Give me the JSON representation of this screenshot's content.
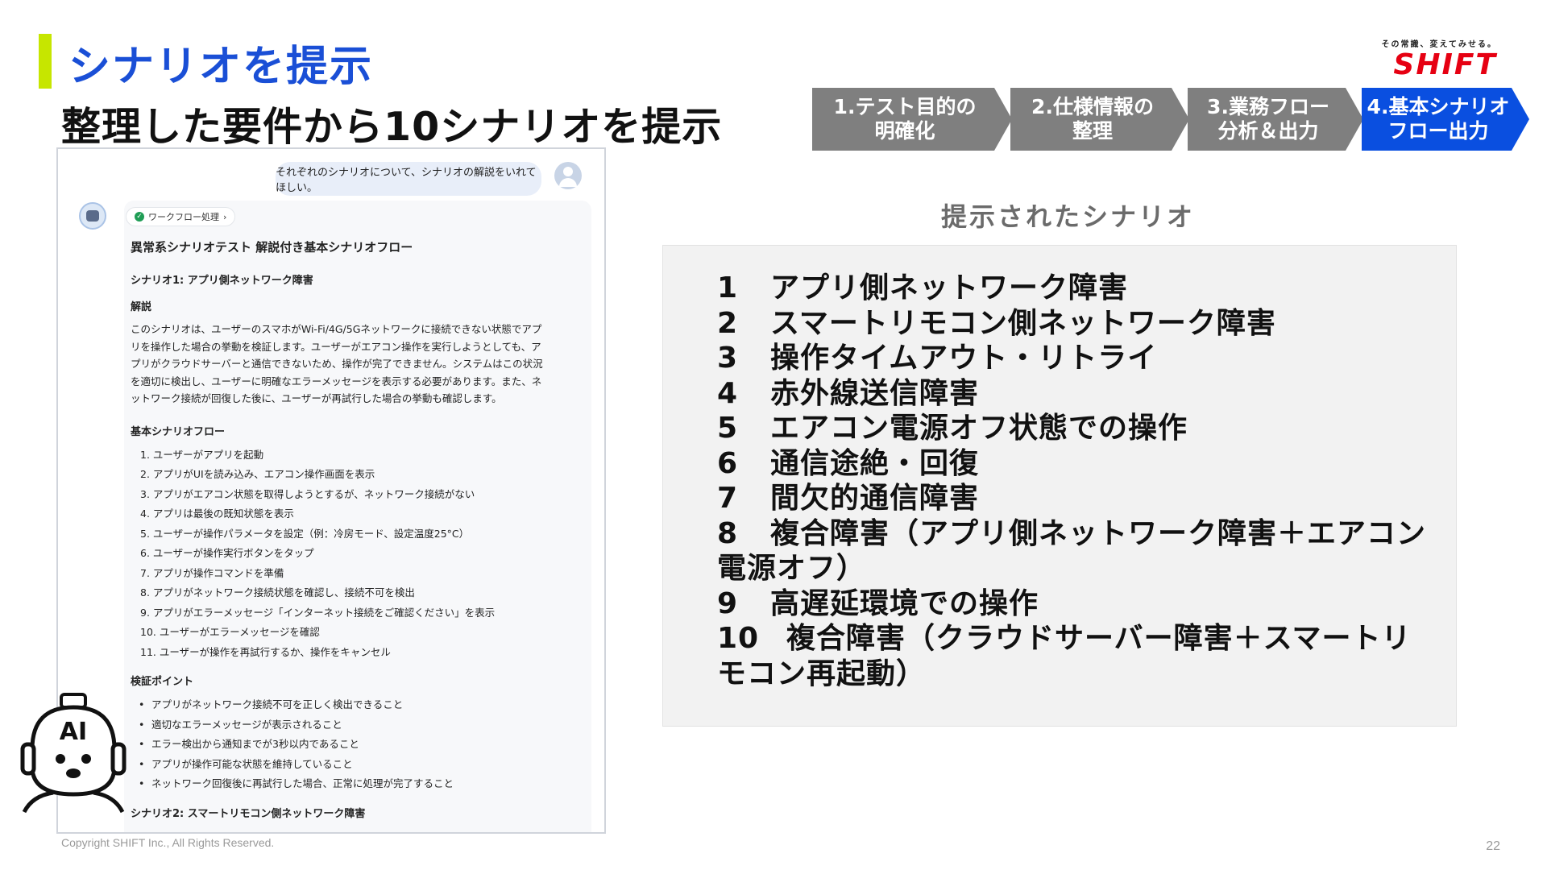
{
  "header": {
    "title": "シナリオを提示",
    "subtitle": "整理した要件から10シナリオを提示"
  },
  "logo": {
    "tagline": "その常識、変えてみせる。",
    "brand": "SHIFT"
  },
  "steps": [
    {
      "label": "1.テスト目的の\n明確化"
    },
    {
      "label": "2.仕様情報の\n整理"
    },
    {
      "label": "3.業務フロー\n分析＆出力"
    },
    {
      "label": "4.基本シナリオ\nフロー出力"
    }
  ],
  "chat": {
    "user_message": "それぞれのシナリオについて、シナリオの解説をいれてほしい。",
    "workflow_tag": "ワークフロー処理",
    "doc_title": "異常系シナリオテスト 解説付き基本シナリオフロー",
    "scenario1_title": "シナリオ1: アプリ側ネットワーク障害",
    "explanation_heading": "解説",
    "explanation": "このシナリオは、ユーザーのスマホがWi-Fi/4G/5Gネットワークに接続できない状態でアプリを操作した場合の挙動を検証します。ユーザーがエアコン操作を実行しようとしても、アプリがクラウドサーバーと通信できないため、操作が完了できません。システムはこの状況を適切に検出し、ユーザーに明確なエラーメッセージを表示する必要があります。また、ネットワーク接続が回復した後に、ユーザーが再試行した場合の挙動も確認します。",
    "flow_heading": "基本シナリオフロー",
    "flow_steps": [
      "1. ユーザーがアプリを起動",
      "2. アプリがUIを読み込み、エアコン操作画面を表示",
      "3. アプリがエアコン状態を取得しようとするが、ネットワーク接続がない",
      "4. アプリは最後の既知状態を表示",
      "5. ユーザーが操作パラメータを設定（例：冷房モード、設定温度25°C）",
      "6. ユーザーが操作実行ボタンをタップ",
      "7. アプリが操作コマンドを準備",
      "8. アプリがネットワーク接続状態を確認し、接続不可を検出",
      "9. アプリがエラーメッセージ「インターネット接続をご確認ください」を表示",
      "10. ユーザーがエラーメッセージを確認",
      "11. ユーザーが操作を再試行するか、操作をキャンセル"
    ],
    "verify_heading": "検証ポイント",
    "verify_points": [
      "アプリがネットワーク接続不可を正しく検出できること",
      "適切なエラーメッセージが表示されること",
      "エラー検出から通知までが3秒以内であること",
      "アプリが操作可能な状態を維持していること",
      "ネットワーク回復後に再試行した場合、正常に処理が完了すること"
    ],
    "scenario2_title": "シナリオ2: スマートリモコン側ネットワーク障害"
  },
  "scenarios": {
    "heading": "提示されたシナリオ",
    "items": [
      {
        "num": "1",
        "text": "アプリ側ネットワーク障害"
      },
      {
        "num": "2",
        "text": "スマートリモコン側ネットワーク障害"
      },
      {
        "num": "3",
        "text": "操作タイムアウト・リトライ"
      },
      {
        "num": "4",
        "text": "赤外線送信障害"
      },
      {
        "num": "5",
        "text": "エアコン電源オフ状態での操作"
      },
      {
        "num": "6",
        "text": "通信途絶・回復"
      },
      {
        "num": "7",
        "text": "間欠的通信障害"
      },
      {
        "num": "8",
        "text": "複合障害（アプリ側ネットワーク障害＋エアコン電源オフ）"
      },
      {
        "num": "9",
        "text": "高遅延環境での操作"
      },
      {
        "num": "10",
        "text": "複合障害（クラウドサーバー障害＋スマートリモコン再起動）"
      }
    ]
  },
  "footer": {
    "copyright": "Copyright SHIFT Inc., All Rights Reserved.",
    "page_number": "22"
  },
  "colors": {
    "accent_blue": "#1a4fd6",
    "bar_green": "#c6e600",
    "step_gray": "#7f7f7f",
    "step_active": "#0a4fe0",
    "brand_red": "#e60012"
  }
}
